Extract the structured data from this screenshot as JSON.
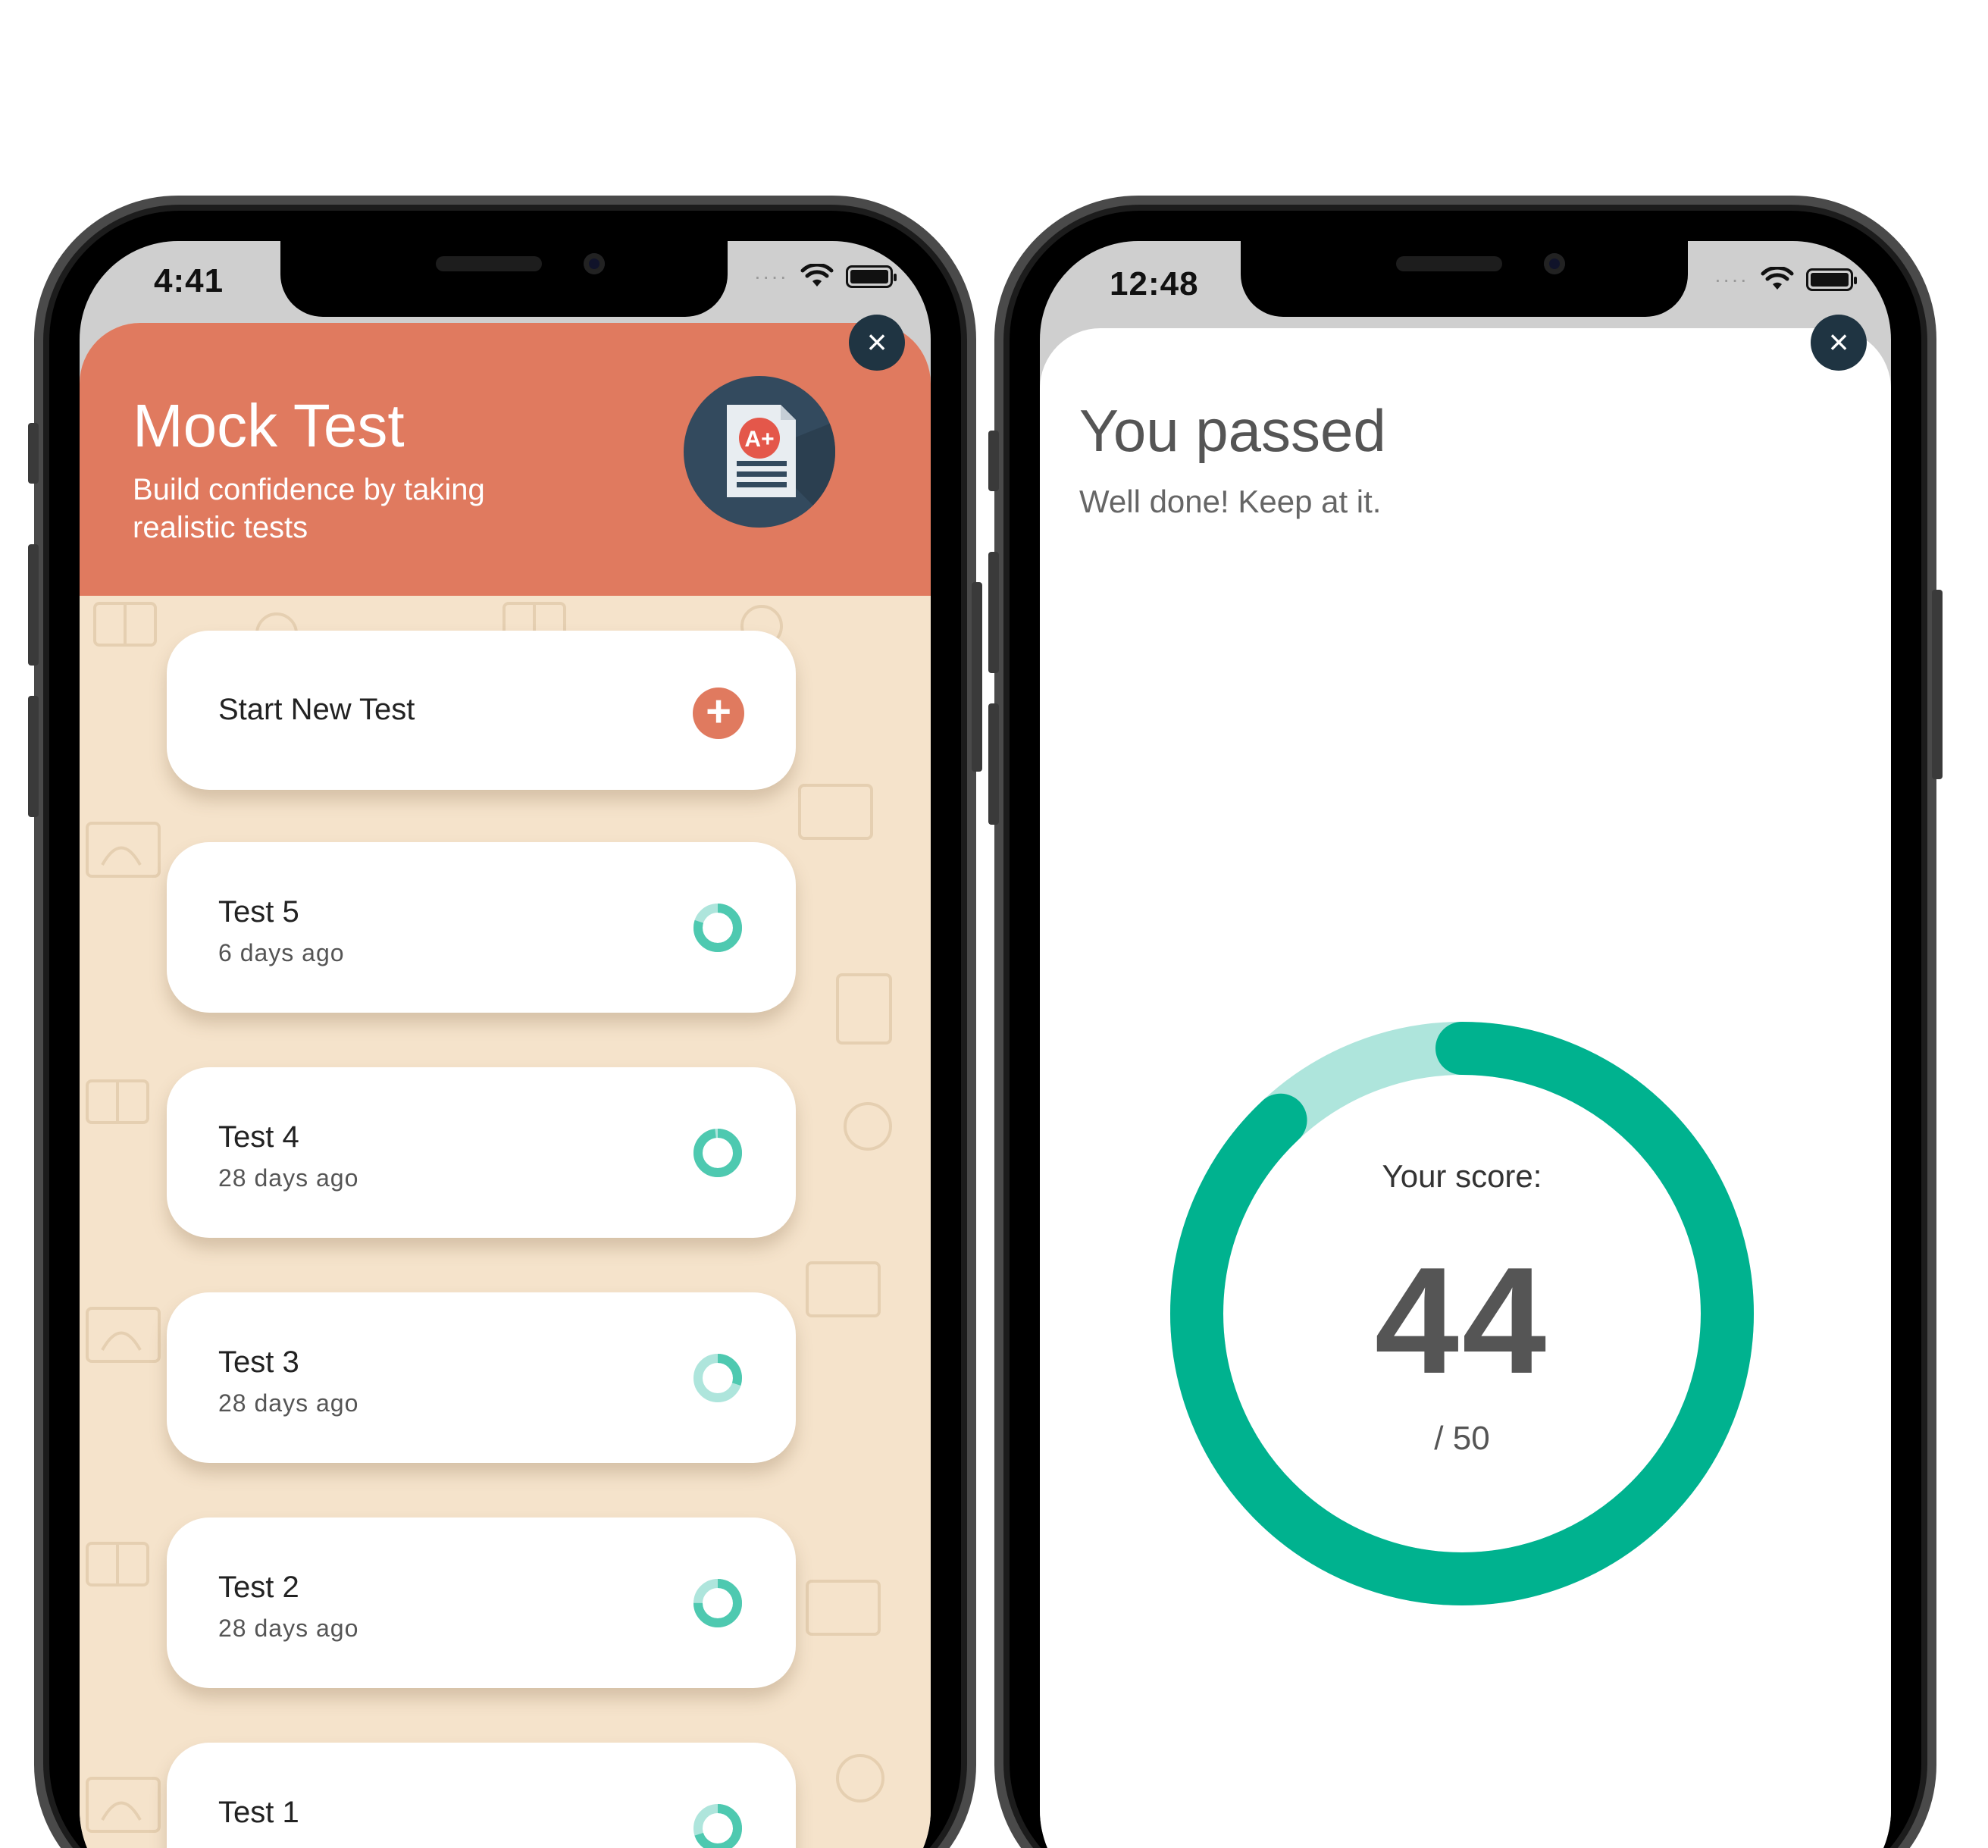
{
  "left_phone": {
    "status": {
      "time": "4:41"
    },
    "hero": {
      "title": "Mock Test",
      "subtitle": "Build confidence by taking realistic tests",
      "icon": "grade-document-icon",
      "badge_text": "A+"
    },
    "start_card": {
      "label": "Start New Test",
      "icon": "plus-icon"
    },
    "tests": [
      {
        "title": "Test 5",
        "when": "6 days ago",
        "progress": 0.8
      },
      {
        "title": "Test 4",
        "when": "28 days ago",
        "progress": 0.98
      },
      {
        "title": "Test 3",
        "when": "28 days ago",
        "progress": 0.3
      },
      {
        "title": "Test 2",
        "when": "28 days ago",
        "progress": 0.75
      },
      {
        "title": "Test 1",
        "when": "",
        "progress": 0.7
      }
    ],
    "close_icon": "close-icon"
  },
  "right_phone": {
    "status": {
      "time": "12:48"
    },
    "title": "You passed",
    "subtitle": "Well done! Keep at it.",
    "score": {
      "label": "Your score:",
      "value": "44",
      "total": "/ 50",
      "fraction": 0.88
    },
    "close_icon": "close-icon"
  },
  "colors": {
    "accent": "#e07a5f",
    "navy": "#1f3442",
    "teal": "#00b28f",
    "teal_light": "#aee5dc",
    "ring_teal": "#4ec9b0",
    "pattern_bg": "#f5e3cb"
  }
}
